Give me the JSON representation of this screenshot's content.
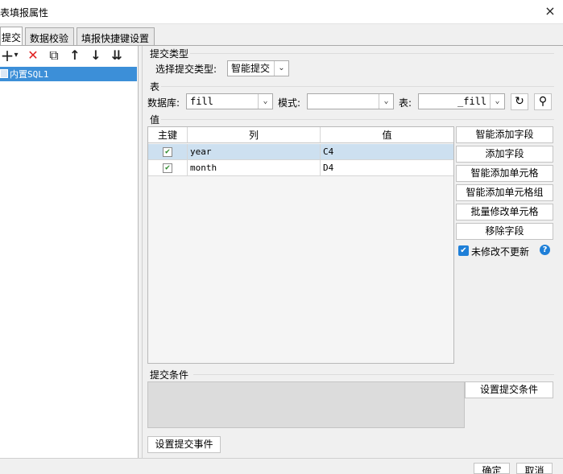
{
  "window": {
    "title": "表填报属性",
    "close_icon": "×"
  },
  "tabs": [
    {
      "label": "提交",
      "active": true
    },
    {
      "label": "数据校验",
      "active": false
    },
    {
      "label": "填报快捷键设置",
      "active": false
    }
  ],
  "left_toolbar": {
    "add": "+",
    "add_arrow": "▾",
    "delete": "✕",
    "copy": "⧉",
    "up": "↑",
    "down": "↓",
    "sort": "⇊"
  },
  "tree": {
    "items": [
      {
        "label": "内置SQL1"
      }
    ]
  },
  "submit_type": {
    "section": "提交类型",
    "label": "选择提交类型:",
    "value": "智能提交"
  },
  "table_section": {
    "section": "表",
    "db_label": "数据库:",
    "db_value": "fill",
    "mode_label": "模式:",
    "mode_value": "",
    "table_label": "表:",
    "table_value": "_fill"
  },
  "values_section": {
    "section": "值",
    "columns": [
      "主键",
      "列",
      "值"
    ],
    "rows": [
      {
        "key": true,
        "column": "year",
        "value": "C4"
      },
      {
        "key": true,
        "column": "month",
        "value": "D4"
      }
    ]
  },
  "side_buttons": {
    "smart_add_field": "智能添加字段",
    "add_field": "添加字段",
    "smart_add_cell": "智能添加单元格",
    "smart_add_cell_group": "智能添加单元格组",
    "batch_modify_cell": "批量修改单元格",
    "remove_field": "移除字段",
    "no_update_label": "未修改不更新",
    "no_update_checked": true
  },
  "condition": {
    "section": "提交条件",
    "button": "设置提交条件"
  },
  "event_button": "设置提交事件",
  "footer": {
    "ok": "确定",
    "cancel": "取消"
  },
  "colors": {
    "selection": "#3c8fd8",
    "row_selected": "#cde0f0",
    "help": "#1e7fd8"
  }
}
